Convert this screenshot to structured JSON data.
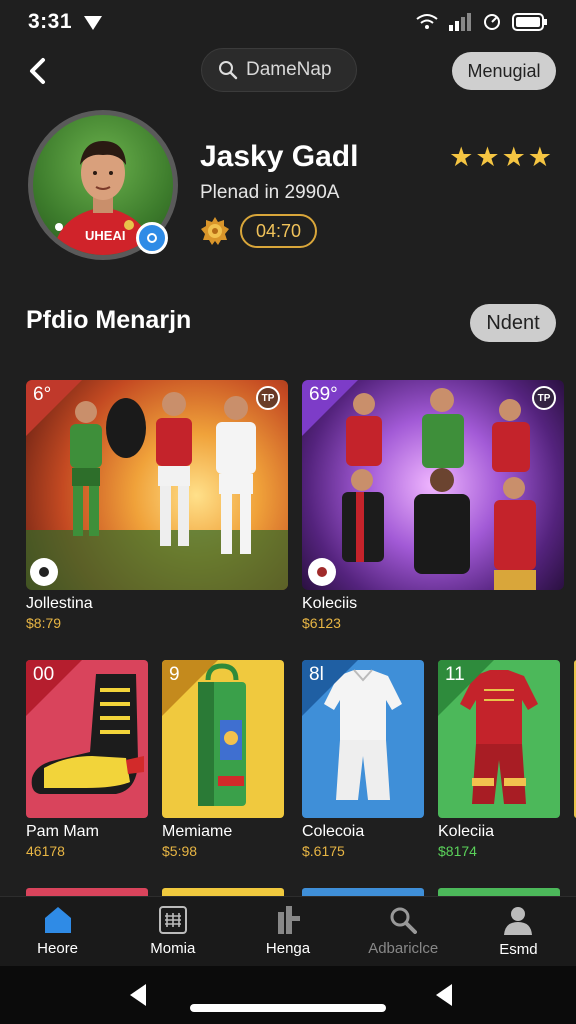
{
  "status": {
    "time": "3:31"
  },
  "header": {
    "search_label": "DameNap",
    "menu_label": "Menugial"
  },
  "profile": {
    "name": "Jasky Gadl",
    "subtitle": "Plenad in 2990A",
    "score": "04:70",
    "rating": 4,
    "jersey_text": "UHEAI"
  },
  "section": {
    "title": "Pfdio Menarjn",
    "next_label": "Ndent"
  },
  "featured": [
    {
      "badge": "6°",
      "tag": "TP",
      "label": "Jollestina",
      "price": "$8:79",
      "accent": "#c0392b"
    },
    {
      "badge": "69°",
      "tag": "TP",
      "label": "Koleciis",
      "price": "$6123",
      "accent": "#7d3cc8"
    }
  ],
  "items": [
    {
      "badge": "00",
      "label": "Pam Mam",
      "price": "46178",
      "bg": "#d9445c",
      "corner": "#b51e2e",
      "price_color": "#e7b544"
    },
    {
      "badge": "9",
      "label": "Memiame",
      "price": "$5:98",
      "bg": "#f0c93e",
      "corner": "#c48a1d",
      "price_color": "#e7b544"
    },
    {
      "badge": "8l",
      "label": "Colecoia",
      "price": "$.6175",
      "bg": "#3f8fd8",
      "corner": "#1f5fa3",
      "price_color": "#e7b544"
    },
    {
      "badge": "11",
      "label": "Koleciia",
      "price": "$8174",
      "bg": "#4cb85a",
      "corner": "#2e8b3c",
      "price_color": "#5ad15a"
    }
  ],
  "nav": [
    {
      "label": "Heore",
      "icon": "home-icon",
      "active": true
    },
    {
      "label": "Momia",
      "icon": "grid-icon",
      "active": false
    },
    {
      "label": "Henga",
      "icon": "bar-icon",
      "active": false
    },
    {
      "label": "Adbariclce",
      "icon": "search-icon",
      "active": false
    },
    {
      "label": "Esmd",
      "icon": "person-icon",
      "active": false
    }
  ]
}
